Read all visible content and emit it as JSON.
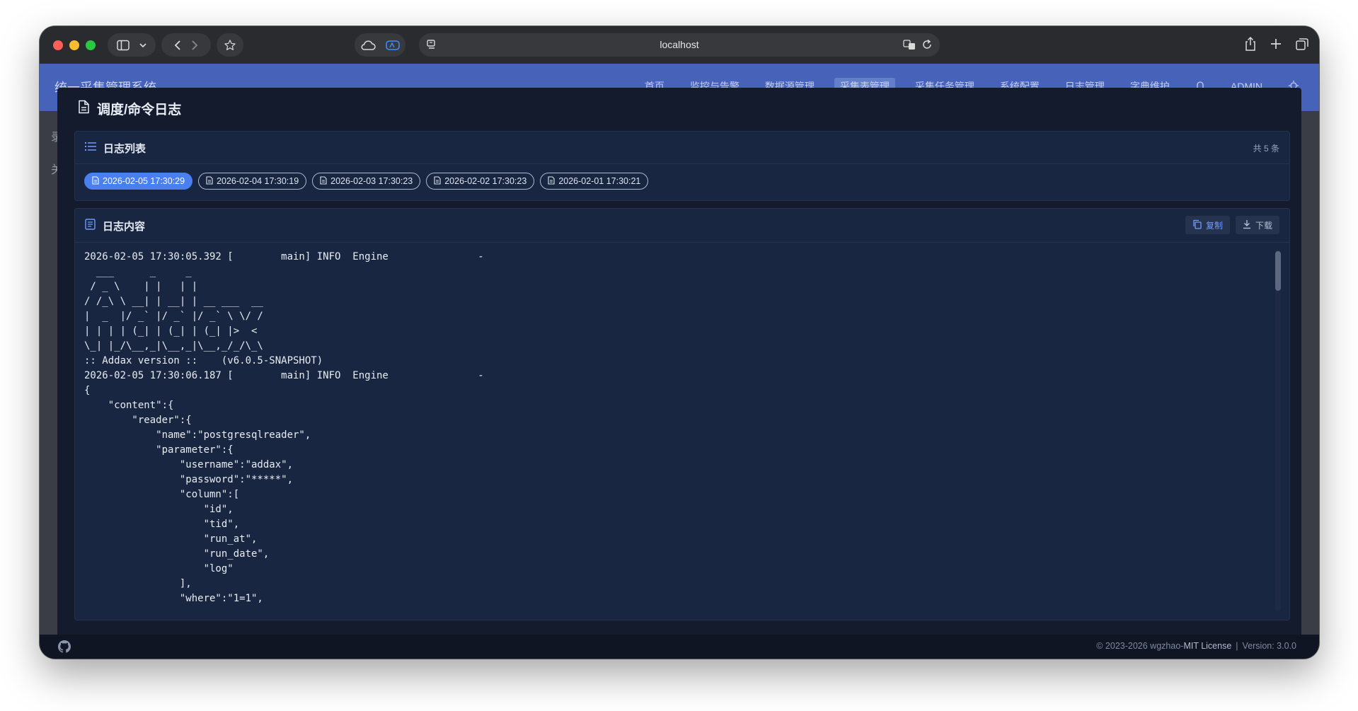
{
  "browser": {
    "url": "localhost",
    "icons": {
      "sidebar": "sidebar-icon",
      "back": "chevron-left-icon",
      "forward": "chevron-right-icon",
      "favorite": "star-icon",
      "share": "share-icon",
      "new_tab": "plus-icon",
      "tabs": "tabs-overview-icon"
    }
  },
  "app": {
    "title": "统一采集管理系统",
    "nav": [
      "首页",
      "监控与告警",
      "数据源管理",
      "采集表管理",
      "采集任务管理",
      "系统配置",
      "日志管理",
      "字典维护"
    ],
    "active_nav": "采集表管理",
    "user": "ADMIN",
    "side_letters": [
      "录",
      "关"
    ]
  },
  "modal": {
    "title": "调度/命令日志",
    "list_card": {
      "title": "日志列表",
      "count": "共 5 条",
      "files": [
        {
          "label": "2026-02-05 17:30:29",
          "active": true
        },
        {
          "label": "2026-02-04 17:30:19",
          "active": false
        },
        {
          "label": "2026-02-03 17:30:23",
          "active": false
        },
        {
          "label": "2026-02-02 17:30:23",
          "active": false
        },
        {
          "label": "2026-02-01 17:30:21",
          "active": false
        }
      ]
    },
    "content_card": {
      "title": "日志内容",
      "copy_label": "复制",
      "download_label": "下载",
      "lines": [
        "2026-02-05 17:30:05.392 [        main] INFO  Engine               -",
        "  ___      _     _",
        " / _ \\    | |   | |",
        "/ /_\\ \\ __| | __| | __ ___  __",
        "|  _  |/ _` |/ _` |/ _` \\ \\/ /",
        "| | | | (_| | (_| | (_| |>  <",
        "\\_| |_/\\__,_|\\__,_|\\__,_/_/\\_\\",
        ":: Addax version ::    (v6.0.5-SNAPSHOT)",
        "2026-02-05 17:30:06.187 [        main] INFO  Engine               -",
        "{",
        "    \"content\":{",
        "        \"reader\":{",
        "            \"name\":\"postgresqlreader\",",
        "            \"parameter\":{",
        "                \"username\":\"addax\",",
        "                \"password\":\"*****\",",
        "                \"column\":[",
        "                    \"id\",",
        "                    \"tid\",",
        "                    \"run_at\",",
        "                    \"run_date\",",
        "                    \"log\"",
        "                ],",
        "                \"where\":\"1=1\","
      ]
    }
  },
  "footer": {
    "copyright": "© 2023-2026 wgzhao-",
    "license": "MIT License",
    "separator": "|",
    "version": "Version: 3.0.0"
  }
}
